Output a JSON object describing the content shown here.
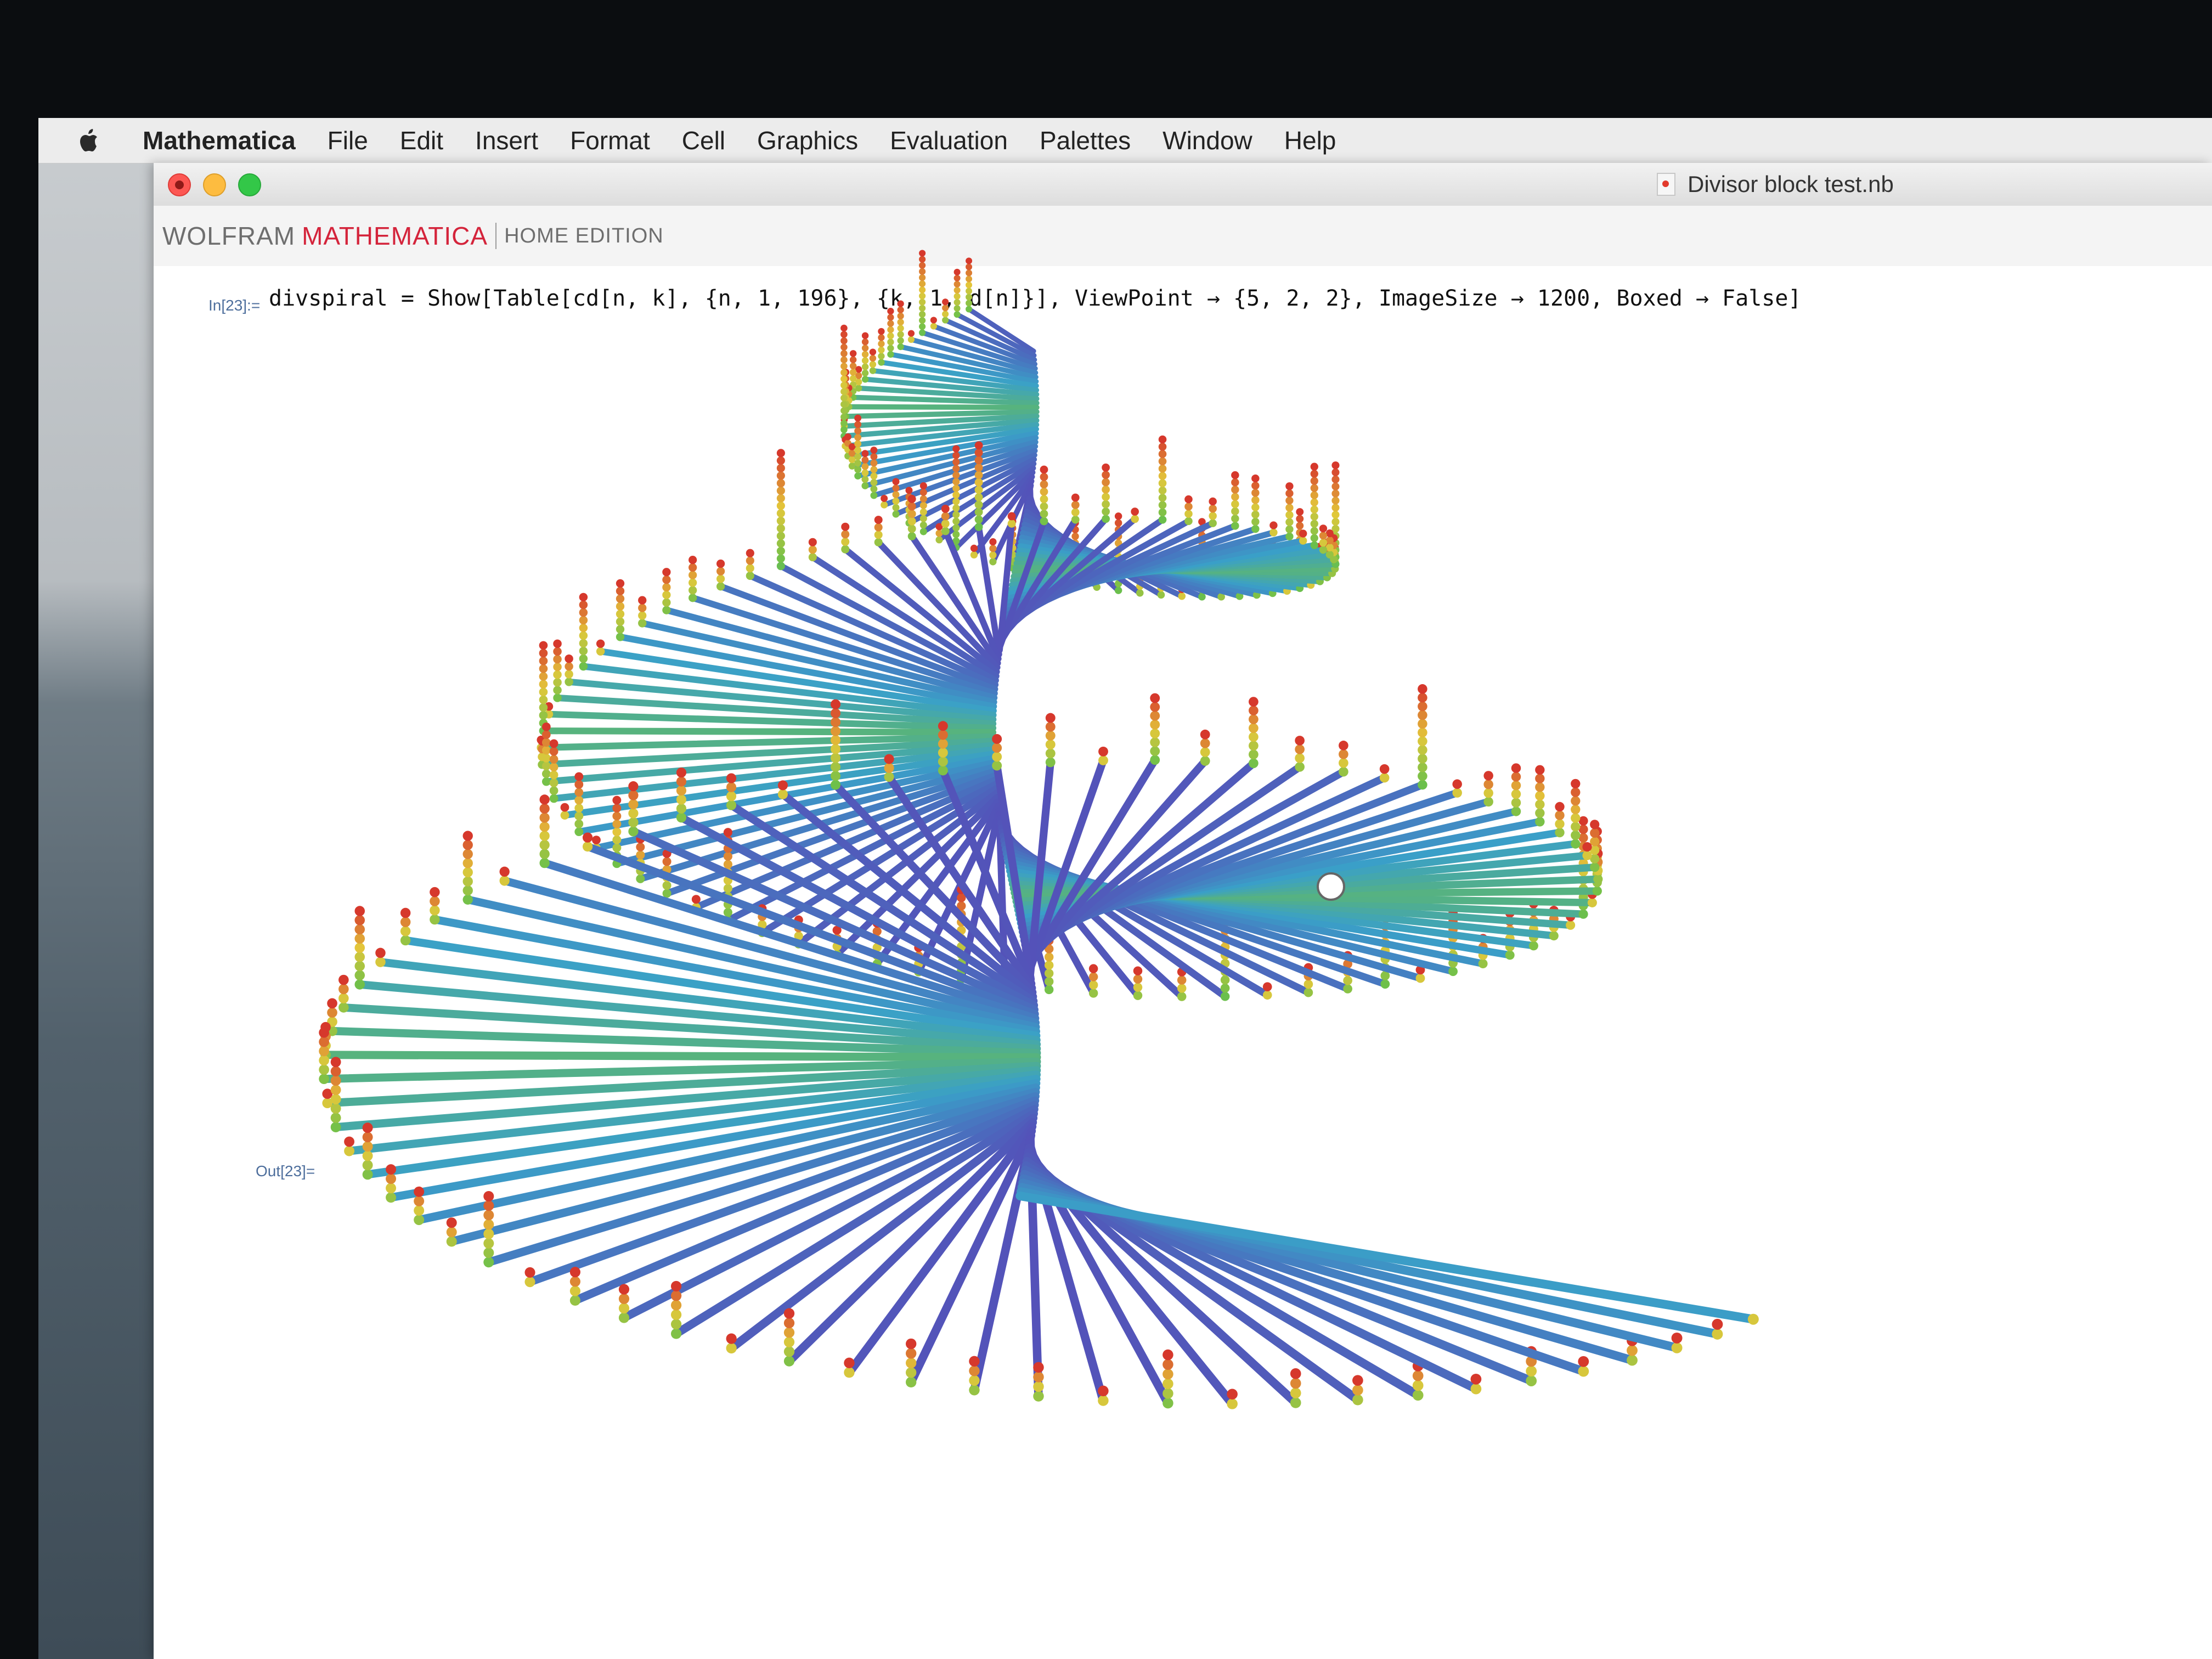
{
  "menubar": {
    "app_name": "Mathematica",
    "items": [
      "File",
      "Edit",
      "Insert",
      "Format",
      "Cell",
      "Graphics",
      "Evaluation",
      "Palettes",
      "Window",
      "Help"
    ]
  },
  "window": {
    "document_title": "Divisor block test.nb"
  },
  "toolbar": {
    "brand_wolfram": "WOLFRAM",
    "brand_mathematica": "MATHEMATICA",
    "brand_edition": "HOME EDITION"
  },
  "notebook": {
    "input_label": "In[23]:=",
    "input_code": "divspiral = Show[Table[cd[n, k], {n, 1, 196}, {k, 1, d[n]}], ViewPoint → {5, 2, 2}, ImageSize → 1200, Boxed → False]",
    "output_label": "Out[23]="
  },
  "graphic": {
    "description_colors": {
      "base": "#5a3fb5",
      "mid": "#3aa0c8",
      "green": "#6cc04a",
      "yellow": "#e3c83a",
      "tip": "#d6382c"
    },
    "n_max": 196
  }
}
